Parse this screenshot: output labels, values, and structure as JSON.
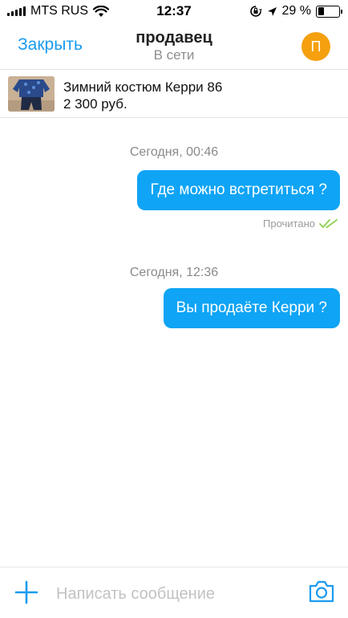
{
  "status_bar": {
    "carrier": "MTS RUS",
    "time": "12:37",
    "battery_percent_label": "29 %",
    "battery_level": 0.29
  },
  "header": {
    "close_label": "Закрыть",
    "title": "продавец",
    "subtitle": "В сети",
    "avatar_letter": "П",
    "avatar_color": "#f5a00f"
  },
  "product": {
    "name": "Зимний костюм Керри 86",
    "price": "2 300 руб."
  },
  "messages": [
    {
      "date": "Сегодня, 00:46",
      "text": "Где можно встретиться ?",
      "status": "Прочитано"
    },
    {
      "date": "Сегодня, 12:36",
      "text": "Вы продаёте Керри ?"
    }
  ],
  "composer": {
    "placeholder": "Написать сообщение"
  },
  "colors": {
    "accent": "#1a9bf0",
    "bubble": "#0fa4f5",
    "read_check": "#8fd14f"
  }
}
